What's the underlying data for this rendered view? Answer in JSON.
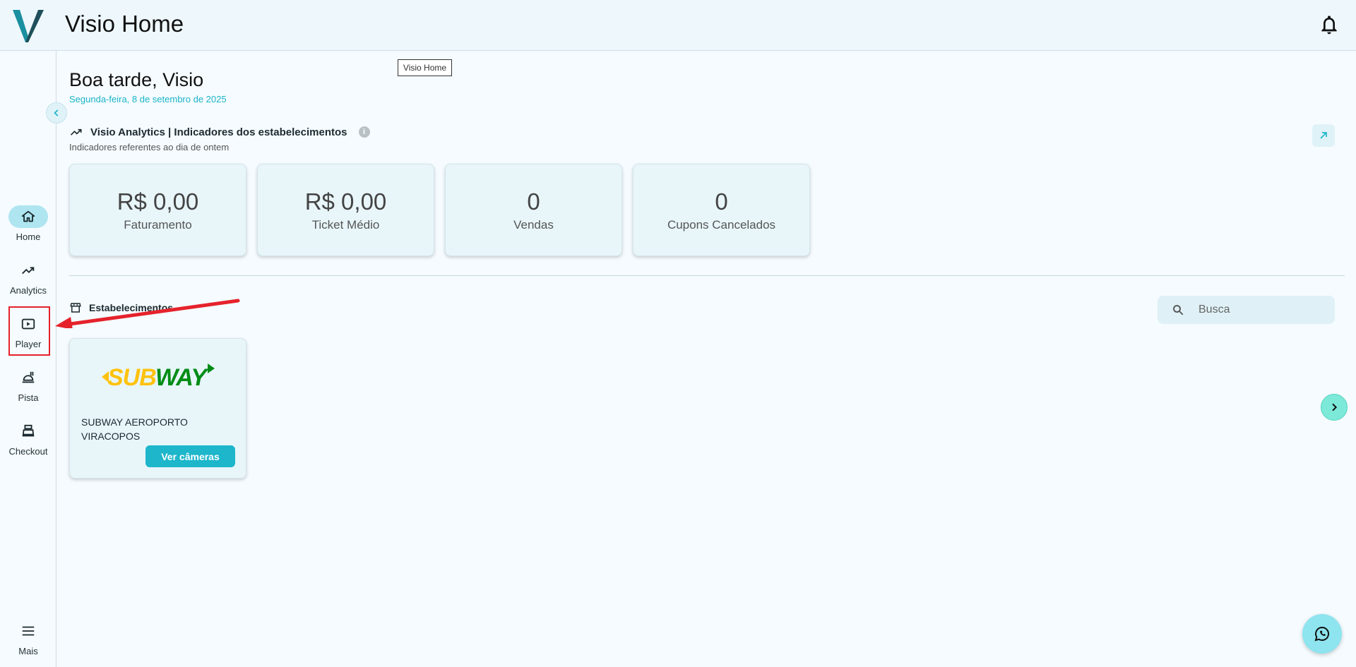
{
  "header": {
    "title": "Visio Home",
    "logo_icon": "visio-v-logo",
    "notification_icon": "bell-icon"
  },
  "tooltip": {
    "text": "Visio Home"
  },
  "sidebar": {
    "items": [
      {
        "label": "Home",
        "icon": "home-icon",
        "active": true
      },
      {
        "label": "Analytics",
        "icon": "trending-up-icon",
        "active": false
      },
      {
        "label": "Player",
        "icon": "play-box-icon",
        "active": false,
        "highlighted": true
      },
      {
        "label": "Pista",
        "icon": "food-tray-icon",
        "active": false
      },
      {
        "label": "Checkout",
        "icon": "cash-register-icon",
        "active": false
      }
    ],
    "more": {
      "label": "Mais",
      "icon": "menu-icon"
    }
  },
  "main": {
    "greeting": "Boa tarde, Visio",
    "date": "Segunda-feira, 8 de setembro de 2025",
    "analytics": {
      "title": "Visio Analytics | Indicadores dos estabelecimentos",
      "subtitle": "Indicadores referentes ao dia de ontem",
      "info_glyph": "i",
      "kpis": [
        {
          "value": "R$ 0,00",
          "label": "Faturamento"
        },
        {
          "value": "R$ 0,00",
          "label": "Ticket Médio"
        },
        {
          "value": "0",
          "label": "Vendas"
        },
        {
          "value": "0",
          "label": "Cupons Cancelados"
        }
      ]
    },
    "establishments": {
      "title": "Estabelecimentos",
      "search_placeholder": "Busca",
      "items": [
        {
          "name": "SUBWAY AEROPORTO VIRACOPOS",
          "logo": "SUBWAY",
          "button_label": "Ver câmeras"
        }
      ]
    }
  },
  "colors": {
    "accent": "#1eb6cb",
    "active_nav": "#aee5f0",
    "highlight": "#e5222b",
    "subway_yellow": "#ffc20e",
    "subway_green": "#008c15"
  }
}
